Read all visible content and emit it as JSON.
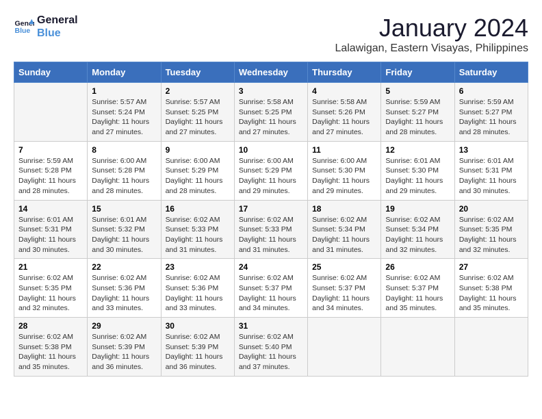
{
  "logo": {
    "line1": "General",
    "line2": "Blue"
  },
  "title": "January 2024",
  "location": "Lalawigan, Eastern Visayas, Philippines",
  "days_of_week": [
    "Sunday",
    "Monday",
    "Tuesday",
    "Wednesday",
    "Thursday",
    "Friday",
    "Saturday"
  ],
  "weeks": [
    [
      {
        "day": "",
        "info": ""
      },
      {
        "day": "1",
        "info": "Sunrise: 5:57 AM\nSunset: 5:24 PM\nDaylight: 11 hours\nand 27 minutes."
      },
      {
        "day": "2",
        "info": "Sunrise: 5:57 AM\nSunset: 5:25 PM\nDaylight: 11 hours\nand 27 minutes."
      },
      {
        "day": "3",
        "info": "Sunrise: 5:58 AM\nSunset: 5:25 PM\nDaylight: 11 hours\nand 27 minutes."
      },
      {
        "day": "4",
        "info": "Sunrise: 5:58 AM\nSunset: 5:26 PM\nDaylight: 11 hours\nand 27 minutes."
      },
      {
        "day": "5",
        "info": "Sunrise: 5:59 AM\nSunset: 5:27 PM\nDaylight: 11 hours\nand 28 minutes."
      },
      {
        "day": "6",
        "info": "Sunrise: 5:59 AM\nSunset: 5:27 PM\nDaylight: 11 hours\nand 28 minutes."
      }
    ],
    [
      {
        "day": "7",
        "info": "Sunrise: 5:59 AM\nSunset: 5:28 PM\nDaylight: 11 hours\nand 28 minutes."
      },
      {
        "day": "8",
        "info": "Sunrise: 6:00 AM\nSunset: 5:28 PM\nDaylight: 11 hours\nand 28 minutes."
      },
      {
        "day": "9",
        "info": "Sunrise: 6:00 AM\nSunset: 5:29 PM\nDaylight: 11 hours\nand 28 minutes."
      },
      {
        "day": "10",
        "info": "Sunrise: 6:00 AM\nSunset: 5:29 PM\nDaylight: 11 hours\nand 29 minutes."
      },
      {
        "day": "11",
        "info": "Sunrise: 6:00 AM\nSunset: 5:30 PM\nDaylight: 11 hours\nand 29 minutes."
      },
      {
        "day": "12",
        "info": "Sunrise: 6:01 AM\nSunset: 5:30 PM\nDaylight: 11 hours\nand 29 minutes."
      },
      {
        "day": "13",
        "info": "Sunrise: 6:01 AM\nSunset: 5:31 PM\nDaylight: 11 hours\nand 30 minutes."
      }
    ],
    [
      {
        "day": "14",
        "info": "Sunrise: 6:01 AM\nSunset: 5:31 PM\nDaylight: 11 hours\nand 30 minutes."
      },
      {
        "day": "15",
        "info": "Sunrise: 6:01 AM\nSunset: 5:32 PM\nDaylight: 11 hours\nand 30 minutes."
      },
      {
        "day": "16",
        "info": "Sunrise: 6:02 AM\nSunset: 5:33 PM\nDaylight: 11 hours\nand 31 minutes."
      },
      {
        "day": "17",
        "info": "Sunrise: 6:02 AM\nSunset: 5:33 PM\nDaylight: 11 hours\nand 31 minutes."
      },
      {
        "day": "18",
        "info": "Sunrise: 6:02 AM\nSunset: 5:34 PM\nDaylight: 11 hours\nand 31 minutes."
      },
      {
        "day": "19",
        "info": "Sunrise: 6:02 AM\nSunset: 5:34 PM\nDaylight: 11 hours\nand 32 minutes."
      },
      {
        "day": "20",
        "info": "Sunrise: 6:02 AM\nSunset: 5:35 PM\nDaylight: 11 hours\nand 32 minutes."
      }
    ],
    [
      {
        "day": "21",
        "info": "Sunrise: 6:02 AM\nSunset: 5:35 PM\nDaylight: 11 hours\nand 32 minutes."
      },
      {
        "day": "22",
        "info": "Sunrise: 6:02 AM\nSunset: 5:36 PM\nDaylight: 11 hours\nand 33 minutes."
      },
      {
        "day": "23",
        "info": "Sunrise: 6:02 AM\nSunset: 5:36 PM\nDaylight: 11 hours\nand 33 minutes."
      },
      {
        "day": "24",
        "info": "Sunrise: 6:02 AM\nSunset: 5:37 PM\nDaylight: 11 hours\nand 34 minutes."
      },
      {
        "day": "25",
        "info": "Sunrise: 6:02 AM\nSunset: 5:37 PM\nDaylight: 11 hours\nand 34 minutes."
      },
      {
        "day": "26",
        "info": "Sunrise: 6:02 AM\nSunset: 5:37 PM\nDaylight: 11 hours\nand 35 minutes."
      },
      {
        "day": "27",
        "info": "Sunrise: 6:02 AM\nSunset: 5:38 PM\nDaylight: 11 hours\nand 35 minutes."
      }
    ],
    [
      {
        "day": "28",
        "info": "Sunrise: 6:02 AM\nSunset: 5:38 PM\nDaylight: 11 hours\nand 35 minutes."
      },
      {
        "day": "29",
        "info": "Sunrise: 6:02 AM\nSunset: 5:39 PM\nDaylight: 11 hours\nand 36 minutes."
      },
      {
        "day": "30",
        "info": "Sunrise: 6:02 AM\nSunset: 5:39 PM\nDaylight: 11 hours\nand 36 minutes."
      },
      {
        "day": "31",
        "info": "Sunrise: 6:02 AM\nSunset: 5:40 PM\nDaylight: 11 hours\nand 37 minutes."
      },
      {
        "day": "",
        "info": ""
      },
      {
        "day": "",
        "info": ""
      },
      {
        "day": "",
        "info": ""
      }
    ]
  ]
}
